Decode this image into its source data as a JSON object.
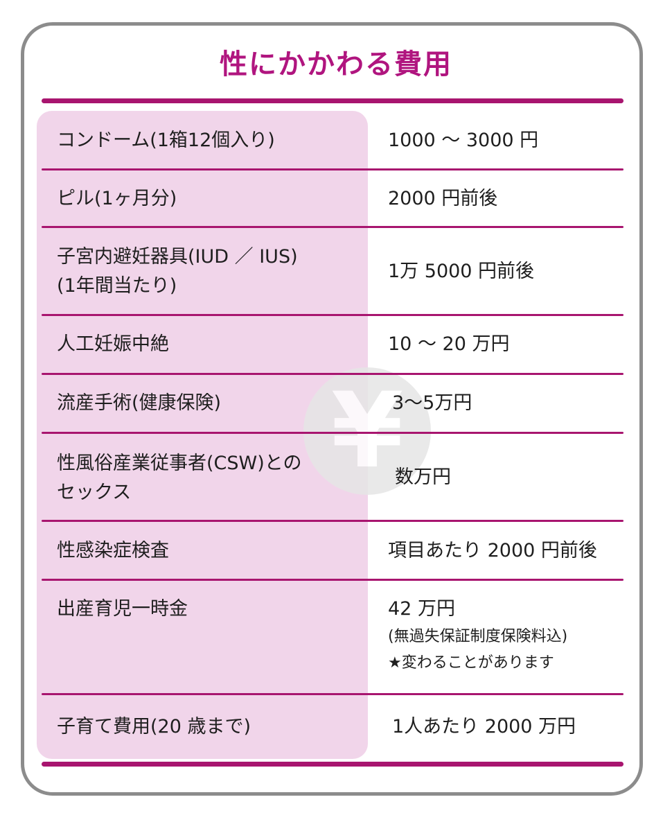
{
  "title": "性にかかわる費用",
  "rows": [
    {
      "item": [
        "コンドーム(1箱12個入り)"
      ],
      "cost": [
        "1000 ～ 3000 円"
      ]
    },
    {
      "item": [
        "ピル(1ヶ月分)"
      ],
      "cost": [
        "2000 円前後"
      ]
    },
    {
      "item": [
        "子宮内避妊器具(IUD ／ IUS)",
        "(1年間当たり)"
      ],
      "cost": [
        "1万 5000 円前後"
      ]
    },
    {
      "item": [
        "人工妊娠中絶"
      ],
      "cost": [
        "10 ～ 20 万円"
      ]
    },
    {
      "item": [
        "流産手術(健康保険)"
      ],
      "cost": [
        "3～5万円"
      ]
    },
    {
      "item": [
        "性風俗産業従事者(CSW)との",
        "セックス"
      ],
      "cost": [
        "数万円"
      ]
    },
    {
      "item": [
        "性感染症検査"
      ],
      "cost": [
        "項目あたり 2000 円前後"
      ]
    },
    {
      "item": [
        "出産育児一時金"
      ],
      "cost": [
        "42 万円",
        "(無過失保証制度保険料込)",
        "★変わることがあります"
      ]
    },
    {
      "item": [
        "子育て費用(20 歳まで)"
      ],
      "cost": [
        "1人あたり 2000 万円"
      ]
    }
  ],
  "watermark_icon": "yen-icon",
  "colors": {
    "accent": "#b0157f",
    "rule": "#a8156f",
    "item_bg": "#f1d5ea",
    "frame": "#8c8c8c"
  }
}
